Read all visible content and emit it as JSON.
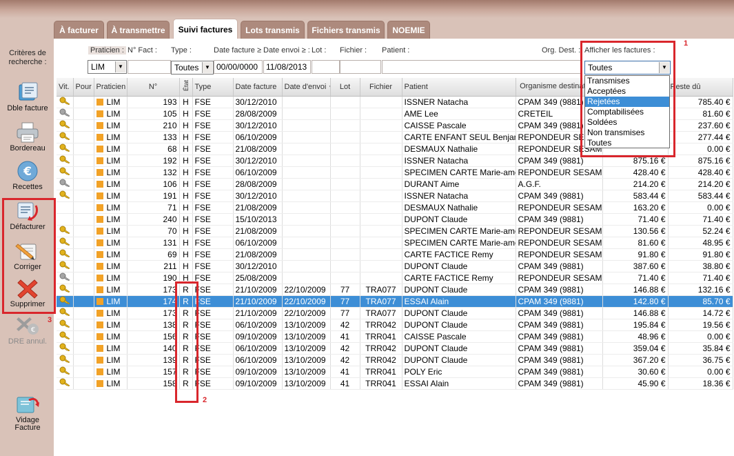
{
  "tabs": [
    "À facturer",
    "À transmettre",
    "Suivi factures",
    "Lots transmis",
    "Fichiers transmis",
    "NOEMIE"
  ],
  "active_tab_index": 2,
  "sidebar": {
    "criteria_label": "Critères de recherche :",
    "buttons": {
      "dble_facture": "Dble facture",
      "bordereau": "Bordereau",
      "recettes": "Recettes",
      "defacturer": "Défacturer",
      "corriger": "Corriger",
      "supprimer": "Supprimer",
      "dre_annul": "DRE annul.",
      "vidage": "Vidage Facture"
    }
  },
  "filters": {
    "praticien_label": "Praticien :",
    "nfact_label": "N° Fact :",
    "type_label": "Type :",
    "date_facture_label": "Date facture ≥",
    "date_envoi_label": "Date envoi ≥ :",
    "lot_label": "Lot :",
    "fichier_label": "Fichier :",
    "patient_label": "Patient :",
    "org_label": "Org. Dest. :",
    "afficher_label": "Afficher les factures :",
    "praticien_value": "LIM",
    "type_value": "Toutes",
    "date_facture_value": "00/00/0000",
    "date_envoi_value": "11/08/2013",
    "afficher_value": "Toutes"
  },
  "dropdown": {
    "options": [
      "Transmises",
      "Acceptées",
      "Rejetées",
      "Comptabilisées",
      "Soldées",
      "Non transmises",
      "Toutes"
    ],
    "highlighted_index": 2
  },
  "annotations": {
    "n1": "1",
    "n2": "2",
    "n3": "3"
  },
  "table": {
    "headers": {
      "vit": "Vit.",
      "pour": "Pour",
      "praticien": "Praticien",
      "num": "N°",
      "etat": "État",
      "type": "Type",
      "date_facture": "Date facture",
      "date_envoi": "Date d'envoi",
      "lot": "Lot",
      "fichier": "Fichier",
      "patient": "Patient",
      "org": "Organisme destinataire",
      "montant": "",
      "reste": "Reste dû"
    },
    "selected_row_index": 17,
    "rows": [
      {
        "key": "gold",
        "prat": "LIM",
        "num": "193",
        "etat": "H",
        "type": "FSE",
        "df": "30/12/2010",
        "de": "",
        "lot": "",
        "fichier": "",
        "patient": "ISSNER Natacha",
        "org": "CPAM 349 (9881)",
        "montant": "",
        "reste": "785.40 €"
      },
      {
        "key": "grey",
        "prat": "LIM",
        "num": "105",
        "etat": "H",
        "type": "FSE",
        "df": "28/08/2009",
        "de": "",
        "lot": "",
        "fichier": "",
        "patient": "AME Lee",
        "org": "CRETEIL",
        "montant": "",
        "reste": "81.60 €"
      },
      {
        "key": "gold",
        "prat": "LIM",
        "num": "210",
        "etat": "H",
        "type": "FSE",
        "df": "30/12/2010",
        "de": "",
        "lot": "",
        "fichier": "",
        "patient": "CAISSE Pascale",
        "org": "CPAM 349 (9881)",
        "montant": "",
        "reste": "237.60 €"
      },
      {
        "key": "gold",
        "prat": "LIM",
        "num": "133",
        "etat": "H",
        "type": "FSE",
        "df": "06/10/2009",
        "de": "",
        "lot": "",
        "fichier": "",
        "patient": "CARTE ENFANT SEUL Benjam",
        "org": "REPONDEUR SESAM",
        "montant": "",
        "reste": "277.44 €"
      },
      {
        "key": "gold",
        "prat": "LIM",
        "num": "68",
        "etat": "H",
        "type": "FSE",
        "df": "21/08/2009",
        "de": "",
        "lot": "",
        "fichier": "",
        "patient": "DESMAUX Nathalie",
        "org": "REPONDEUR SESAM",
        "montant": "",
        "reste": "0.00 €"
      },
      {
        "key": "gold",
        "prat": "LIM",
        "num": "192",
        "etat": "H",
        "type": "FSE",
        "df": "30/12/2010",
        "de": "",
        "lot": "",
        "fichier": "",
        "patient": "ISSNER Natacha",
        "org": "CPAM 349 (9881)",
        "montant": "875.16 €",
        "reste": "875.16 €"
      },
      {
        "key": "gold",
        "prat": "LIM",
        "num": "132",
        "etat": "H",
        "type": "FSE",
        "df": "06/10/2009",
        "de": "",
        "lot": "",
        "fichier": "",
        "patient": "SPECIMEN CARTE Marie-amé",
        "org": "REPONDEUR SESAM",
        "montant": "428.40 €",
        "reste": "428.40 €"
      },
      {
        "key": "grey",
        "prat": "LIM",
        "num": "106",
        "etat": "H",
        "type": "FSE",
        "df": "28/08/2009",
        "de": "",
        "lot": "",
        "fichier": "",
        "patient": "DURANT Aime",
        "org": "A.G.F.",
        "montant": "214.20 €",
        "reste": "214.20 €"
      },
      {
        "key": "gold",
        "prat": "LIM",
        "num": "191",
        "etat": "H",
        "type": "FSE",
        "df": "30/12/2010",
        "de": "",
        "lot": "",
        "fichier": "",
        "patient": "ISSNER Natacha",
        "org": "CPAM 349 (9881)",
        "montant": "583.44 €",
        "reste": "583.44 €"
      },
      {
        "key": "",
        "prat": "LIM",
        "num": "71",
        "etat": "H",
        "type": "FSE",
        "df": "21/08/2009",
        "de": "",
        "lot": "",
        "fichier": "",
        "patient": "DESMAUX Nathalie",
        "org": "REPONDEUR SESAM",
        "montant": "163.20 €",
        "reste": "0.00 €"
      },
      {
        "key": "",
        "prat": "LIM",
        "num": "240",
        "etat": "H",
        "type": "FSE",
        "df": "15/10/2013",
        "de": "",
        "lot": "",
        "fichier": "",
        "patient": "DUPONT Claude",
        "org": "CPAM 349 (9881)",
        "montant": "71.40 €",
        "reste": "71.40 €"
      },
      {
        "key": "gold",
        "prat": "LIM",
        "num": "70",
        "etat": "H",
        "type": "FSE",
        "df": "21/08/2009",
        "de": "",
        "lot": "",
        "fichier": "",
        "patient": "SPECIMEN CARTE Marie-amé",
        "org": "REPONDEUR SESAM",
        "montant": "130.56 €",
        "reste": "52.24 €"
      },
      {
        "key": "gold",
        "prat": "LIM",
        "num": "131",
        "etat": "H",
        "type": "FSE",
        "df": "06/10/2009",
        "de": "",
        "lot": "",
        "fichier": "",
        "patient": "SPECIMEN CARTE Marie-amé",
        "org": "REPONDEUR SESAM",
        "montant": "81.60 €",
        "reste": "48.95 €"
      },
      {
        "key": "gold",
        "prat": "LIM",
        "num": "69",
        "etat": "H",
        "type": "FSE",
        "df": "21/08/2009",
        "de": "",
        "lot": "",
        "fichier": "",
        "patient": "CARTE FACTICE Remy",
        "org": "REPONDEUR SESAM",
        "montant": "91.80 €",
        "reste": "91.80 €"
      },
      {
        "key": "gold",
        "prat": "LIM",
        "num": "211",
        "etat": "H",
        "type": "FSE",
        "df": "30/12/2010",
        "de": "",
        "lot": "",
        "fichier": "",
        "patient": "DUPONT Claude",
        "org": "CPAM 349 (9881)",
        "montant": "387.60 €",
        "reste": "38.80 €"
      },
      {
        "key": "grey",
        "prat": "LIM",
        "num": "190",
        "etat": "H",
        "type": "FSE",
        "df": "25/08/2009",
        "de": "",
        "lot": "",
        "fichier": "",
        "patient": "CARTE FACTICE Remy",
        "org": "REPONDEUR SESAM",
        "montant": "71.40 €",
        "reste": "71.40 €"
      },
      {
        "key": "gold",
        "prat": "LIM",
        "num": "173",
        "etat": "R",
        "type": "FSE",
        "df": "21/10/2009",
        "de": "22/10/2009",
        "lot": "77",
        "fichier": "TRA077",
        "patient": "DUPONT Claude",
        "org": "CPAM 349 (9881)",
        "montant": "146.88 €",
        "reste": "132.16 €"
      },
      {
        "key": "gold",
        "prat": "LIM",
        "num": "174",
        "etat": "R",
        "type": "FSE",
        "df": "21/10/2009",
        "de": "22/10/2009",
        "lot": "77",
        "fichier": "TRA077",
        "patient": "ESSAI Alain",
        "org": "CPAM 349 (9881)",
        "montant": "142.80 €",
        "reste": "85.70 €"
      },
      {
        "key": "gold",
        "prat": "LIM",
        "num": "173",
        "etat": "R",
        "type": "FSE",
        "df": "21/10/2009",
        "de": "22/10/2009",
        "lot": "77",
        "fichier": "TRA077",
        "patient": "DUPONT Claude",
        "org": "CPAM 349 (9881)",
        "montant": "146.88 €",
        "reste": "14.72 €"
      },
      {
        "key": "gold",
        "prat": "LIM",
        "num": "138",
        "etat": "R",
        "type": "FSE",
        "df": "06/10/2009",
        "de": "13/10/2009",
        "lot": "42",
        "fichier": "TRR042",
        "patient": "DUPONT Claude",
        "org": "CPAM 349 (9881)",
        "montant": "195.84 €",
        "reste": "19.56 €"
      },
      {
        "key": "gold",
        "prat": "LIM",
        "num": "156",
        "etat": "R",
        "type": "FSE",
        "df": "09/10/2009",
        "de": "13/10/2009",
        "lot": "41",
        "fichier": "TRR041",
        "patient": "CAISSE Pascale",
        "org": "CPAM 349 (9881)",
        "montant": "48.96 €",
        "reste": "0.00 €"
      },
      {
        "key": "gold",
        "prat": "LIM",
        "num": "140",
        "etat": "R",
        "type": "FSE",
        "df": "06/10/2009",
        "de": "13/10/2009",
        "lot": "42",
        "fichier": "TRR042",
        "patient": "DUPONT Claude",
        "org": "CPAM 349 (9881)",
        "montant": "359.04 €",
        "reste": "35.84 €"
      },
      {
        "key": "gold",
        "prat": "LIM",
        "num": "139",
        "etat": "R",
        "type": "FSE",
        "df": "06/10/2009",
        "de": "13/10/2009",
        "lot": "42",
        "fichier": "TRR042",
        "patient": "DUPONT Claude",
        "org": "CPAM 349 (9881)",
        "montant": "367.20 €",
        "reste": "36.75 €"
      },
      {
        "key": "gold",
        "prat": "LIM",
        "num": "157",
        "etat": "R",
        "type": "FSE",
        "df": "09/10/2009",
        "de": "13/10/2009",
        "lot": "41",
        "fichier": "TRR041",
        "patient": "POLY Eric",
        "org": "CPAM 349 (9881)",
        "montant": "30.60 €",
        "reste": "0.00 €"
      },
      {
        "key": "gold",
        "prat": "LIM",
        "num": "158",
        "etat": "R",
        "type": "FSE",
        "df": "09/10/2009",
        "de": "13/10/2009",
        "lot": "41",
        "fichier": "TRR041",
        "patient": "ESSAI Alain",
        "org": "CPAM 349 (9881)",
        "montant": "45.90 €",
        "reste": "18.36 €"
      }
    ]
  },
  "colors": {
    "accent_red": "#d9262c",
    "selection_blue": "#3d8ed6",
    "tab_brown": "#ad8a7d",
    "praticien_orange": "#f2a227"
  }
}
